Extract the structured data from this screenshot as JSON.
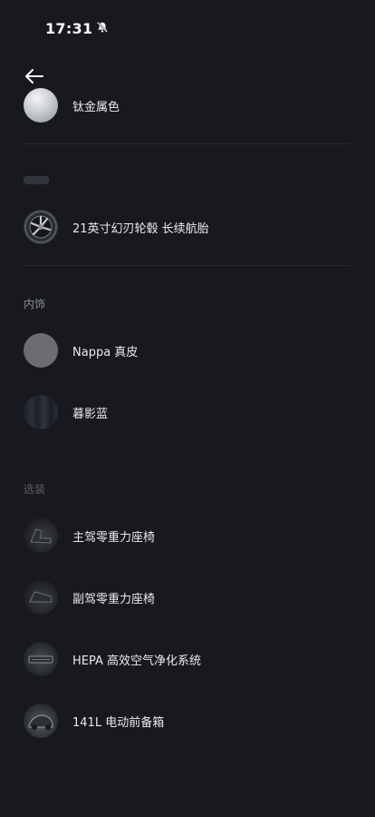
{
  "status_bar": {
    "time": "17:31",
    "mute_icon": "bell-slash-icon"
  },
  "navigation": {
    "back_icon": "arrow-left-icon"
  },
  "exterior": {
    "items": [
      {
        "label": "钛金属色",
        "icon": "metal-swatch-icon"
      },
      {
        "label": "21英寸幻刃轮毂 长续航胎",
        "icon": "wheel-icon"
      }
    ]
  },
  "interior": {
    "title": "内饰",
    "items": [
      {
        "label": "Nappa 真皮",
        "icon": "leather-swatch-icon"
      },
      {
        "label": "暮影蓝",
        "icon": "blue-trim-swatch-icon"
      }
    ]
  },
  "options": {
    "title": "选装",
    "items": [
      {
        "label": "主驾零重力座椅",
        "icon": "driver-seat-icon"
      },
      {
        "label": "副驾零重力座椅",
        "icon": "passenger-seat-icon"
      },
      {
        "label": "HEPA 高效空气净化系统",
        "icon": "air-filter-icon"
      },
      {
        "label": "141L 电动前备箱",
        "icon": "front-trunk-icon"
      }
    ]
  }
}
